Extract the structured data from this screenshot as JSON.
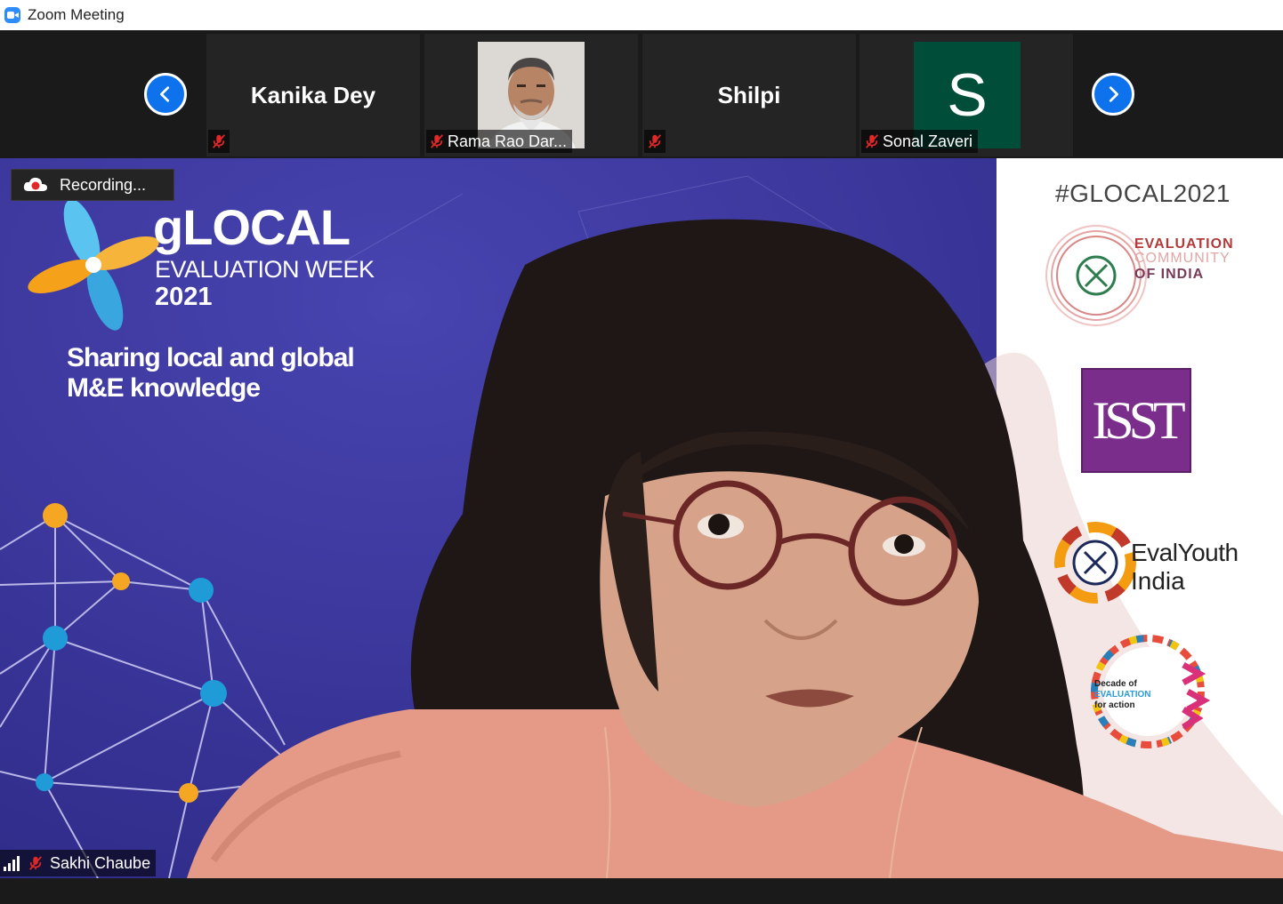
{
  "window": {
    "title": "Zoom Meeting",
    "app_icon": "zoom-camera-icon"
  },
  "gallery": {
    "prev_icon": "chevron-left-icon",
    "next_icon": "chevron-right-icon",
    "accent_color": "#0e72ed",
    "participants": [
      {
        "name": "Kanika Dey",
        "label": "",
        "muted": true
      },
      {
        "name": "",
        "label": "Rama Rao Dar...",
        "muted": true
      },
      {
        "name": "Shilpi",
        "label": "",
        "muted": true
      },
      {
        "name": "",
        "label": "Sonal Zaveri",
        "avatar_letter": "S",
        "avatar_color": "#004d3a",
        "muted": true
      }
    ]
  },
  "main_video": {
    "recording_text": "Recording...",
    "speaker_name": "Sakhi Chaube",
    "speaker_muted": true,
    "background": {
      "logo_title": "gLOCAL",
      "logo_subtitle": "EVALUATION WEEK",
      "logo_year": "2021",
      "tagline_line1": "Sharing local and global",
      "tagline_line2": "M&E knowledge",
      "hashtag": "#GLOCAL2021",
      "eci_line1": "EVALUATION",
      "eci_line2": "COMMUNITY",
      "eci_line3": "OF INDIA",
      "isst": "ISST",
      "evalyouth_line1": "EvalYouth",
      "evalyouth_line2": "India",
      "decade_line1": "Decade of",
      "decade_line2": "EVALUATION",
      "decade_line3": "for action"
    }
  }
}
